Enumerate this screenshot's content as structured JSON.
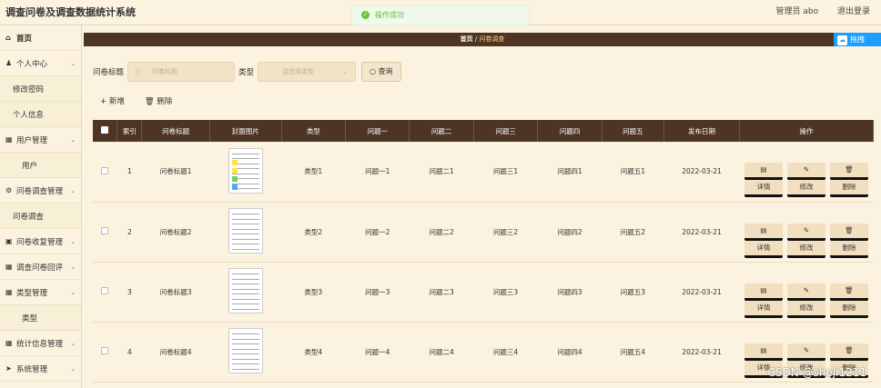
{
  "app": {
    "title": "调查问卷及调查数据统计系统",
    "user": "管理员 abo",
    "logout": "退出登录"
  },
  "toast": {
    "text": "操作成功"
  },
  "sidebar": {
    "items": [
      {
        "label": "首页",
        "icon": "home-icon"
      },
      {
        "label": "个人中心",
        "icon": "user-icon",
        "chevron": true
      },
      {
        "label": "修改密码",
        "sub": true
      },
      {
        "label": "个人信息",
        "sub": true
      },
      {
        "label": "用户管理",
        "icon": "grid-icon",
        "chevron": true
      },
      {
        "label": "用户",
        "sub": true,
        "deep": true
      },
      {
        "label": "问卷调查管理",
        "icon": "gear-icon",
        "chevron": true
      },
      {
        "label": "问卷调查",
        "sub": true
      },
      {
        "label": "问卷收复管理",
        "icon": "lock-icon",
        "chevron": true
      },
      {
        "label": "调查问卷回评",
        "icon": "grid-icon",
        "chevron": true
      },
      {
        "label": "类型管理",
        "icon": "grid-icon",
        "chevron": true
      },
      {
        "label": "类型",
        "sub": true,
        "deep": true
      },
      {
        "label": "统计信息管理",
        "icon": "grid-icon",
        "chevron": true
      },
      {
        "label": "系统管理",
        "icon": "send-icon",
        "chevron": true
      }
    ]
  },
  "breadcrumb": {
    "home": "首页",
    "separator": "/",
    "current": "问卷调查"
  },
  "side_tag": {
    "label": "拖拽"
  },
  "search": {
    "title_label": "问卷标题",
    "title_placeholder": "问卷标题",
    "type_label": "类型",
    "type_placeholder": "请选择类型",
    "button": "查询"
  },
  "ops": {
    "add": "+ 新增",
    "delete": "删除"
  },
  "table": {
    "headers": [
      "",
      "索引",
      "问卷标题",
      "封面图片",
      "类型",
      "问题一",
      "问题二",
      "问题三",
      "问题四",
      "问题五",
      "发布日期",
      "操作"
    ],
    "actions": {
      "detail": "详情",
      "edit": "修改",
      "delete": "删除"
    },
    "rows": [
      {
        "index": "1",
        "title": "问卷标题1",
        "type": "类型1",
        "q1": "问题一1",
        "q2": "问题二1",
        "q3": "问题三1",
        "q4": "问题四1",
        "q5": "问题五1",
        "date": "2022-03-21"
      },
      {
        "index": "2",
        "title": "问卷标题2",
        "type": "类型2",
        "q1": "问题一2",
        "q2": "问题二2",
        "q3": "问题三2",
        "q4": "问题四2",
        "q5": "问题五2",
        "date": "2022-03-21"
      },
      {
        "index": "3",
        "title": "问卷标题3",
        "type": "类型3",
        "q1": "问题一3",
        "q2": "问题二3",
        "q3": "问题三3",
        "q4": "问题四3",
        "q5": "问题五3",
        "date": "2022-03-21"
      },
      {
        "index": "4",
        "title": "问卷标题4",
        "type": "类型4",
        "q1": "问题一4",
        "q2": "问题二4",
        "q3": "问题三4",
        "q4": "问题四4",
        "q5": "问题五4",
        "date": "2022-03-21"
      }
    ]
  },
  "watermark": "CSDN @sheji1211"
}
